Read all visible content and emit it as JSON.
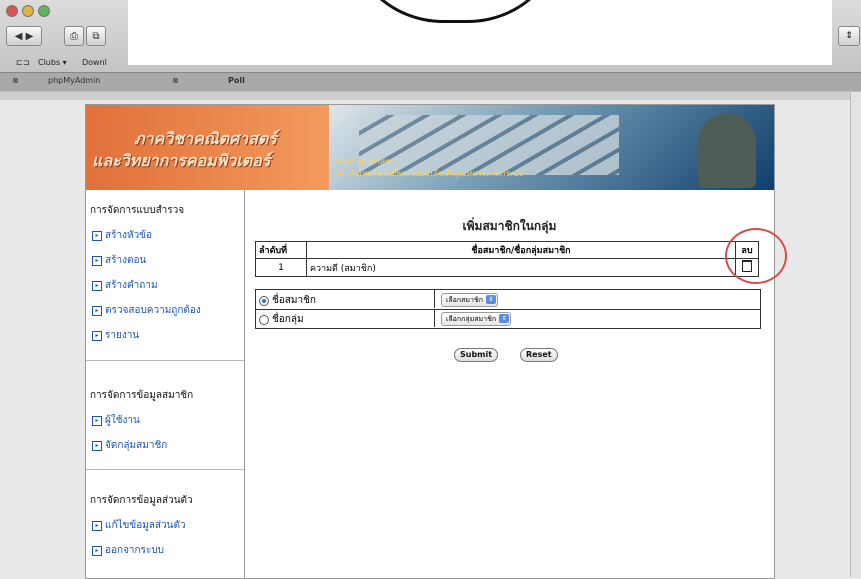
{
  "browser": {
    "bookmarks": [
      "Clubs ▾",
      "Downl"
    ],
    "tabs": [
      "phpMyAdmin",
      "Poll"
    ]
  },
  "banner": {
    "line1": "ภาควิชาคณิตศาสตร์",
    "line2": "และวิทยาการคอมพิวเตอร์",
    "sub1": "คณะวิทยาศาสตร์",
    "sub2": "สถาบันเทคโนโลยีพระจอมเกล้าเจ้าคุณทหารลาดกระบัง"
  },
  "sidebar": {
    "sections": [
      {
        "title": "การจัดการแบบสำรวจ",
        "items": [
          "สร้างหัวข้อ",
          "สร้างตอน",
          "สร้างคำถาม",
          "ตรวจสอบความถูกต้อง",
          "รายงาน"
        ]
      },
      {
        "title": "การจัดการข้อมูลสมาชิก",
        "items": [
          "ผู้ใช้งาน",
          "จัดกลุ่มสมาชิก"
        ]
      },
      {
        "title": "การจัดการข้อมูลส่วนตัว",
        "items": [
          "แก้ไขข้อมูลส่วนตัว",
          "ออกจากระบบ"
        ]
      }
    ]
  },
  "main": {
    "title": "เพิ่มสมาชิกในกลุ่ม",
    "table": {
      "headers": [
        "ลำดับที่",
        "ชื่อสมาชิก/ชื่อกลุ่มสมาชิก",
        "ลบ"
      ],
      "rows": [
        {
          "no": "1",
          "name": "ความดี (สมาชิก)"
        }
      ]
    },
    "options": [
      {
        "label": "ชื่อสมาชิก",
        "select": "เลือกสมาชิก",
        "checked": true
      },
      {
        "label": "ชื่อกลุ่ม",
        "select": "เลือกกลุ่มสมาชิก",
        "checked": false
      }
    ],
    "submit_label": "Submit",
    "reset_label": "Reset"
  },
  "colors": {
    "link": "#1a55b8",
    "annotation": "#d84c4c",
    "banner_orange": "#e0713a"
  }
}
